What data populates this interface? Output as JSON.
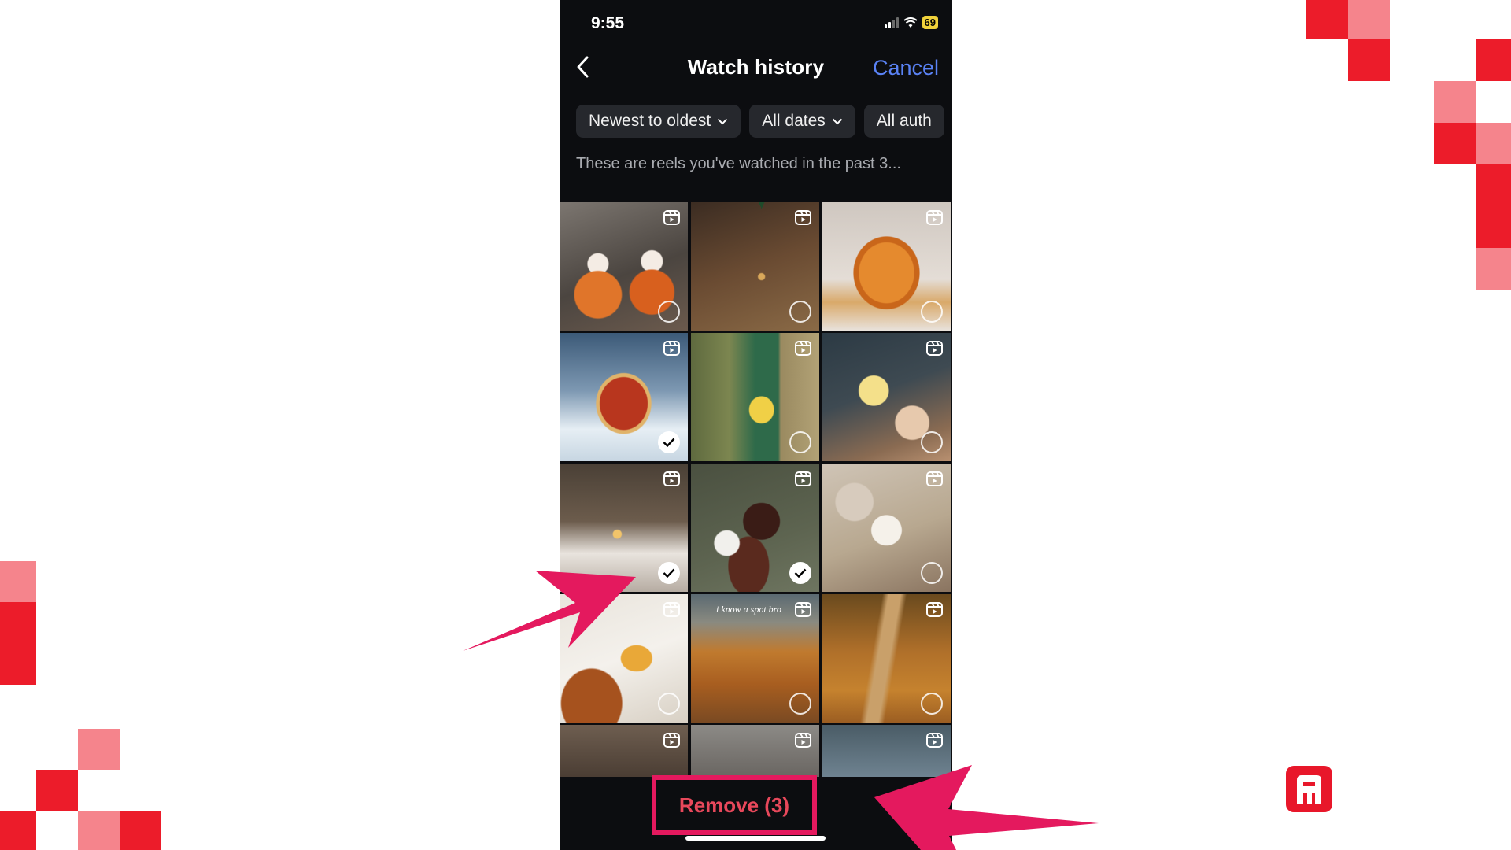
{
  "status": {
    "time": "9:55",
    "battery": "69"
  },
  "header": {
    "title": "Watch history",
    "cancel_label": "Cancel"
  },
  "filters": [
    {
      "label": "Newest to oldest"
    },
    {
      "label": "All dates"
    },
    {
      "label": "All auth"
    }
  ],
  "description": "These are reels you've watched in the past 3...",
  "reels": [
    {
      "scene": "halloween-pumpkin-mugs-with-whipped-cream",
      "selected": false
    },
    {
      "scene": "decorated-christmas-tree-by-fireplace",
      "selected": false
    },
    {
      "scene": "orange-pumpkin-dessert-on-plate",
      "selected": false
    },
    {
      "scene": "christmas-train-in-snowy-forest",
      "selected": true
    },
    {
      "scene": "girl-in-yellow-dress-at-green-door",
      "selected": false
    },
    {
      "scene": "child-eating-under-mushroom-lamp",
      "selected": false
    },
    {
      "scene": "cozy-candlelit-dining-table",
      "selected": true
    },
    {
      "scene": "coffee-cup-and-bag-on-book",
      "selected": true
    },
    {
      "scene": "owl-mug-on-knit-blanket",
      "selected": false
    },
    {
      "scene": "cheesecake-and-autumn-leaf",
      "selected": false
    },
    {
      "scene": "autumn-mountain-road",
      "caption": "i know a spot bro",
      "selected": false
    },
    {
      "scene": "forest-path-with-fallen-leaves",
      "selected": false
    },
    {
      "scene": "fireplace",
      "selected": false
    },
    {
      "scene": "pagoda-in-mist",
      "selected": false
    },
    {
      "scene": "snowy-forest",
      "selected": false
    }
  ],
  "action": {
    "remove_label": "Remove (3)"
  },
  "colors": {
    "accent_blue": "#5a82f5",
    "annotation_pink": "#e4195e",
    "remove_red": "#e8485b",
    "brand_red": "#ec1c2a"
  }
}
